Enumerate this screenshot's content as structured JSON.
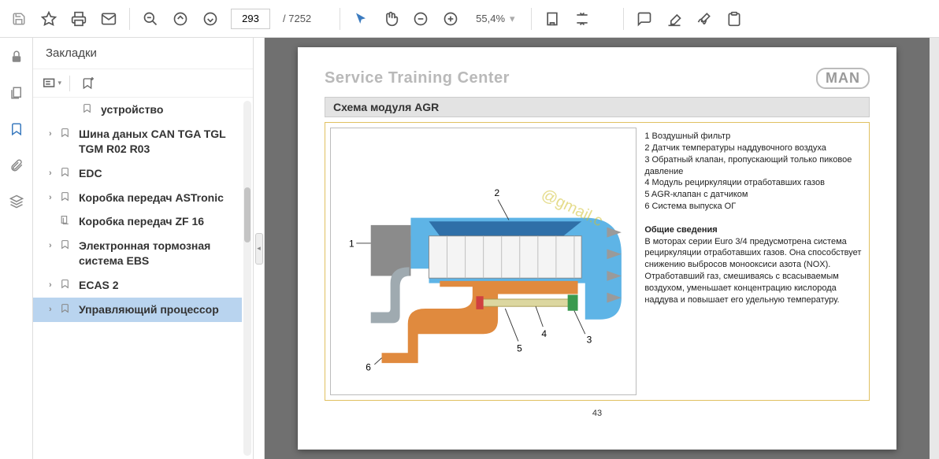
{
  "toolbar": {
    "current_page": "293",
    "total_pages": "7252",
    "zoom": "55,4%"
  },
  "sidebar": {
    "title": "Закладки",
    "items": [
      {
        "label": "устройство",
        "chev": false,
        "child": true
      },
      {
        "label": "Шина даных CAN TGA TGL TGM R02 R03",
        "chev": true
      },
      {
        "label": "EDC",
        "chev": true
      },
      {
        "label": "Коробка передач ASTronic",
        "chev": true
      },
      {
        "label": "Коробка передач ZF 16",
        "chev": false,
        "alt_icon": true
      },
      {
        "label": "Электронная тормозная система EBS",
        "chev": true
      },
      {
        "label": "ECAS 2",
        "chev": true
      },
      {
        "label": "Управляющий процессор",
        "chev": true,
        "selected": true
      }
    ]
  },
  "doc": {
    "header": "Service Training Center",
    "logo": "MAN",
    "section": "Схема модуля AGR",
    "page_number": "43",
    "legend": {
      "items": [
        "1 Воздушный фильтр",
        "2 Датчик температуры наддувочного воздуха",
        "3 Обратный клапан, пропускающий только пиковое давление",
        "4 Модуль рециркуляции отработавших газов",
        "5 AGR-клапан с датчиком",
        "6 Система выпуска ОГ"
      ],
      "subtitle": "Общие сведения",
      "body": "В моторах серии Euro 3/4 предусмотрена система рециркуляции отработавших газов. Она способствует снижению выбросов монооксиси азота (NOX). Отработавший газ, смешиваясь с всасываемым воздухом, уменьшает концентрацию кислорода наддува и повышает его удельную температуру."
    },
    "callouts": {
      "c1": "1",
      "c2": "2",
      "c3": "3",
      "c4": "4",
      "c5": "5",
      "c6": "6"
    }
  }
}
